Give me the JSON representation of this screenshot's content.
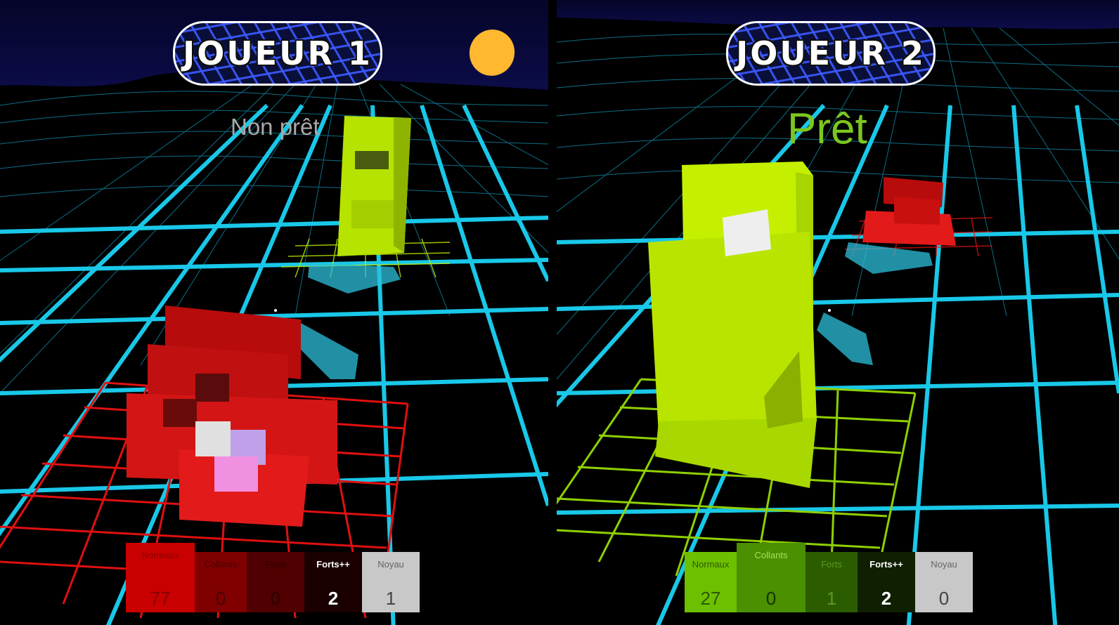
{
  "players": [
    {
      "title": "JOUEUR 1",
      "status": "Non prêt",
      "status_color": "#a8a8a8",
      "stats": [
        {
          "label": "Normaux",
          "value": "77",
          "bg": "#c80000",
          "label_color": "#8a0000",
          "value_color": "#8a0000"
        },
        {
          "label": "Collants",
          "value": "0",
          "bg": "#800000",
          "label_color": "#4a0000",
          "value_color": "#4a0000"
        },
        {
          "label": "Forts",
          "value": "0",
          "bg": "#500000",
          "label_color": "#2a0000",
          "value_color": "#2a0000"
        },
        {
          "label": "Forts++",
          "value": "2",
          "bg": "#1a0000",
          "label_color": "#ffffff",
          "value_color": "#ffffff"
        },
        {
          "label": "Noyau",
          "value": "1",
          "bg": "#c8c8c8",
          "label_color": "#666666",
          "value_color": "#444444"
        }
      ]
    },
    {
      "title": "JOUEUR 2",
      "status": "Prêt",
      "status_color": "#7cc71e",
      "stats": [
        {
          "label": "Normaux",
          "value": "27",
          "bg": "#6cc000",
          "label_color": "#2e5a00",
          "value_color": "#2e5a00"
        },
        {
          "label": "Collants",
          "value": "0",
          "bg": "#4a9000",
          "label_color": "#a6e060",
          "value_color": "#173000"
        },
        {
          "label": "Forts",
          "value": "1",
          "bg": "#2c5c00",
          "label_color": "#5a9a20",
          "value_color": "#5a9a20"
        },
        {
          "label": "Forts++",
          "value": "2",
          "bg": "#0e2000",
          "label_color": "#ffffff",
          "value_color": "#ffffff"
        },
        {
          "label": "Noyau",
          "value": "0",
          "bg": "#c8c8c8",
          "label_color": "#666666",
          "value_color": "#444444"
        }
      ]
    }
  ],
  "colors": {
    "grid": "#19c8e8",
    "sky": "#0a0a3c",
    "player1_piece": "#d41515",
    "player2_piece": "#c4f000",
    "sun": "#ffb830"
  }
}
